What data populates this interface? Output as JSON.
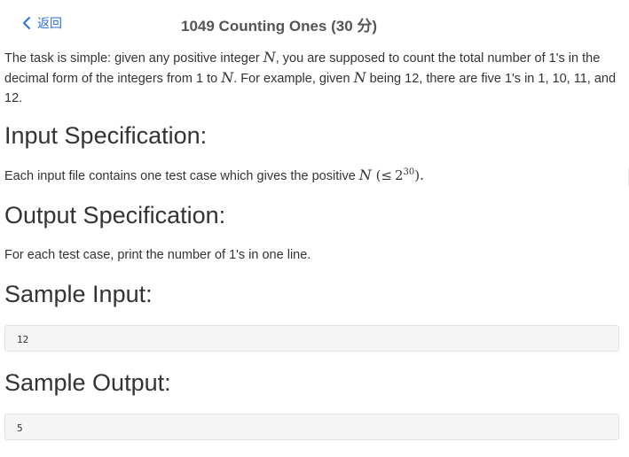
{
  "header": {
    "back_label": "返回",
    "title": "1049 Counting Ones (30 分)"
  },
  "problem": {
    "description": {
      "part1": "The task is simple: given any positive integer ",
      "var_n_1": "N",
      "part2": ", you are supposed to count the total number of 1's in the decimal form of the integers from 1 to ",
      "var_n_2": "N",
      "part3": ". For example, given ",
      "var_n_3": "N",
      "part4": " being 12, there are five 1's in 1, 10, 11, and 12."
    },
    "input_spec": {
      "heading": "Input Specification:",
      "text_before": "Each input file contains one test case which gives the positive ",
      "var_n": "N",
      "paren_open": " (",
      "le": "≤",
      "base": "2",
      "exp": "30",
      "text_after": ")."
    },
    "output_spec": {
      "heading": "Output Specification:",
      "text": "For each test case, print the number of 1's in one line."
    },
    "sample_input": {
      "heading": "Sample Input:",
      "code": "12"
    },
    "sample_output": {
      "heading": "Sample Output:",
      "code": "5"
    }
  },
  "colors": {
    "link": "#2f6fd6",
    "code_bg": "#f5f5f5"
  }
}
